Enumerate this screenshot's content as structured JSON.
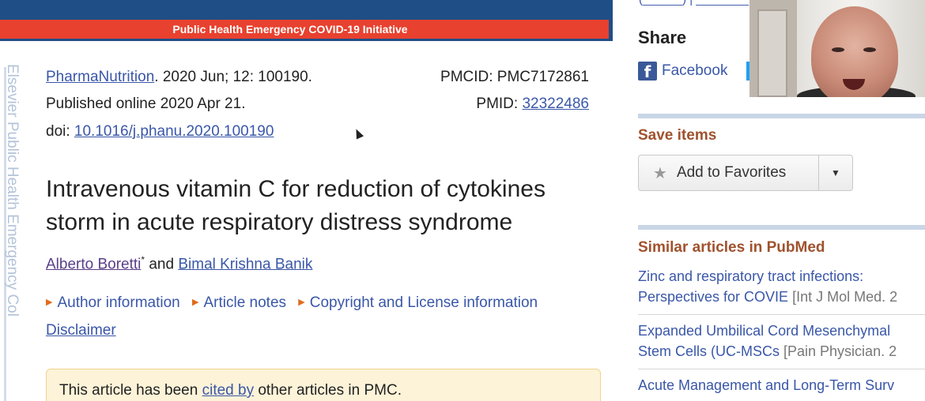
{
  "banner": {
    "initiative": "Public Health Emergency COVID-19 Initiative"
  },
  "sidebar_tab": {
    "text": "Elsevier Public Health Emergency Col"
  },
  "citation": {
    "journal": "PharmaNutrition",
    "journal_rest": ". 2020 Jun; 12: 100190.",
    "published": "Published online 2020 Apr 21.",
    "doi_label": "doi: ",
    "doi": "10.1016/j.phanu.2020.100190",
    "pmcid": "PMCID: PMC7172861",
    "pmid_label": "PMID: ",
    "pmid": "32322486"
  },
  "article": {
    "title_line1": "Intravenous vitamin C for reduction of cytokines",
    "title_line2": "storm in acute respiratory distress syndrome",
    "author1": "Alberto Boretti",
    "author1_mark": "*",
    "and": " and ",
    "author2": "Bimal Krishna Banik",
    "info_links": [
      "Author information",
      "Article notes",
      "Copyright and License information"
    ],
    "disclaimer": "Disclaimer",
    "cited_prefix": "This article has been ",
    "cited_link": "cited by",
    "cited_suffix": " other articles in PMC."
  },
  "right_panel": {
    "top_link_fragment": "(______)  |  ________",
    "share_heading": "Share",
    "facebook_label": "Facebook",
    "save_heading": "Save items",
    "add_favorites": "Add to Favorites",
    "similar_heading": "Similar articles in PubMed",
    "similar": [
      {
        "line1": "Zinc and respiratory tract infections:",
        "line2": "Perspectives for COVIE",
        "src": " [Int J Mol Med. 2"
      },
      {
        "line1": "Expanded Umbilical Cord Mesenchymal",
        "line2": "Stem Cells (UC-MSCs",
        "src": " [Pain Physician. 2"
      },
      {
        "line1": "Acute Management and Long-Term Surv",
        "line2": "",
        "src": ""
      }
    ]
  },
  "icons": {
    "facebook": "facebook-icon",
    "star": "star-icon",
    "dropdown": "caret-down-icon",
    "triangle": "triangle-right-icon"
  },
  "colors": {
    "banner_blue": "#1f4e86",
    "banner_red": "#e8412f",
    "link": "#3a57a8",
    "section_heading": "#a0522d"
  }
}
